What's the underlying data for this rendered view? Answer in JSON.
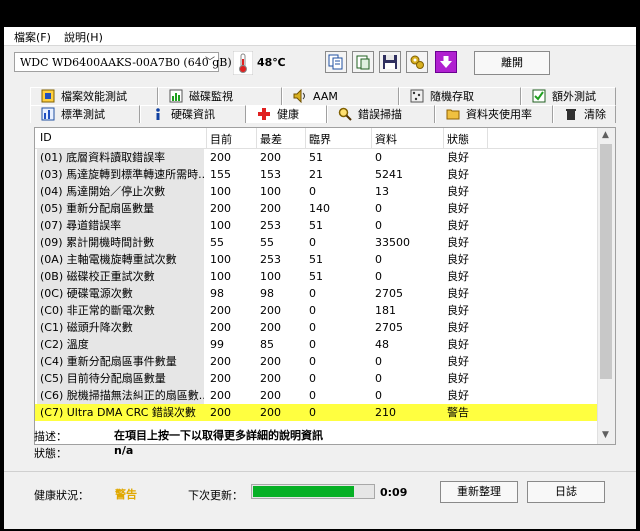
{
  "menu": [
    {
      "label": "檔案(F)"
    },
    {
      "label": "說明(H)"
    }
  ],
  "toolbar": {
    "drive": "WDC WD6400AAKS-00A7B0   (640 gB)",
    "temperature": "48℃",
    "exit_label": "離開"
  },
  "tabs_row1": [
    {
      "label": "檔案效能測試",
      "icon": "file-info-icon"
    },
    {
      "label": "磁碟監視",
      "icon": "chart-icon"
    },
    {
      "label": "AAM",
      "icon": "speaker-icon"
    },
    {
      "label": "隨機存取",
      "icon": "random-access-icon"
    },
    {
      "label": "額外測試",
      "icon": "extra-test-icon"
    }
  ],
  "tabs_row2": [
    {
      "label": "標準測試",
      "icon": "benchmark-icon"
    },
    {
      "label": "硬碟資訊",
      "icon": "info-icon"
    },
    {
      "label": "健康",
      "icon": "health-cross-icon"
    },
    {
      "label": "錯誤掃描",
      "icon": "magnifier-icon"
    },
    {
      "label": "資料夾使用率",
      "icon": "folder-icon"
    },
    {
      "label": "清除",
      "icon": "trash-icon"
    }
  ],
  "table": {
    "columns": [
      "ID",
      "目前",
      "最差",
      "臨界",
      "資料",
      "狀態"
    ],
    "rows": [
      [
        "(01) 底層資料讀取錯誤率",
        "200",
        "200",
        "51",
        "0",
        "良好"
      ],
      [
        "(03) 馬達旋轉到標準轉速所需時...",
        "155",
        "153",
        "21",
        "5241",
        "良好"
      ],
      [
        "(04) 馬達開始／停止次數",
        "100",
        "100",
        "0",
        "13",
        "良好"
      ],
      [
        "(05) 重新分配扇區數量",
        "200",
        "200",
        "140",
        "0",
        "良好"
      ],
      [
        "(07) 尋道錯誤率",
        "100",
        "253",
        "51",
        "0",
        "良好"
      ],
      [
        "(09) 累計開機時間計數",
        "55",
        "55",
        "0",
        "33500",
        "良好"
      ],
      [
        "(0A) 主軸電機旋轉重試次數",
        "100",
        "253",
        "51",
        "0",
        "良好"
      ],
      [
        "(0B) 磁碟校正重試次數",
        "100",
        "100",
        "51",
        "0",
        "良好"
      ],
      [
        "(0C) 硬碟電源次數",
        "98",
        "98",
        "0",
        "2705",
        "良好"
      ],
      [
        "(C0) 非正常的斷電次數",
        "200",
        "200",
        "0",
        "181",
        "良好"
      ],
      [
        "(C1) 磁頭升降次數",
        "200",
        "200",
        "0",
        "2705",
        "良好"
      ],
      [
        "(C2) 溫度",
        "99",
        "85",
        "0",
        "48",
        "良好"
      ],
      [
        "(C4) 重新分配扇區事件數量",
        "200",
        "200",
        "0",
        "0",
        "良好"
      ],
      [
        "(C5) 目前待分配扇區數量",
        "200",
        "200",
        "0",
        "0",
        "良好"
      ],
      [
        "(C6) 脫機掃描無法糾正的扇區數...",
        "200",
        "200",
        "0",
        "0",
        "良好"
      ],
      [
        "(C7) Ultra DMA CRC 錯誤次數",
        "200",
        "200",
        "0",
        "210",
        "警告"
      ]
    ]
  },
  "description": {
    "label": "描述：",
    "value": "在項目上按一下以取得更多詳細的說明資訊",
    "status_label": "狀態：",
    "status_value": "n/a"
  },
  "status_bar": {
    "health_label": "健康狀況：",
    "health_value": "警告",
    "next_update_label": "下次更新：",
    "progress": 0.84,
    "timer": "0:09",
    "refresh_label": "重新整理",
    "log_label": "日誌"
  },
  "colors": {
    "warning_highlight": "#ffff40",
    "health_warning_text": "#e0a800",
    "progress_fill": "#06b025"
  }
}
